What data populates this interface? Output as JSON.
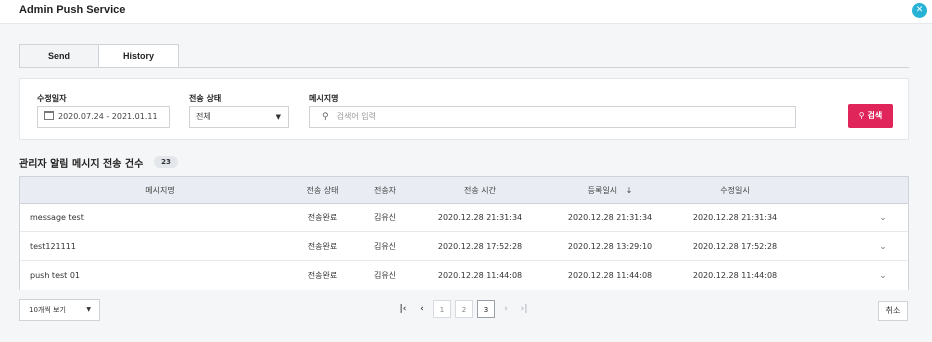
{
  "header": {
    "title": "Admin Push Service",
    "close_icon": "close-icon"
  },
  "tabs": [
    {
      "label": "Send"
    },
    {
      "label": "History"
    }
  ],
  "filters": {
    "date_label": "수정일자",
    "date_value": "2020.07.24 - 2021.01.11",
    "status_label": "전송 상태",
    "status_value": "전체",
    "message_label": "메시지명",
    "search_placeholder": "검색어 입력",
    "search_button": "검색"
  },
  "section": {
    "title": "관리자 알림 메시지 전송 건수",
    "count": "23"
  },
  "table": {
    "columns": [
      "메시지명",
      "전송 상태",
      "전송자",
      "전송 시간",
      "등록일시",
      "수정일시"
    ],
    "sort_icon": "arrow-down-icon",
    "rows": [
      {
        "message": "message test",
        "status": "전송완료",
        "sender": "김유신",
        "sent": "2020.12.28 21:31:34",
        "registered": "2020.12.28 21:31:34",
        "modified": "2020.12.28 21:31:34"
      },
      {
        "message": "test121111",
        "status": "전송완료",
        "sender": "김유신",
        "sent": "2020.12.28 17:52:28",
        "registered": "2020.12.28 13:29:10",
        "modified": "2020.12.28 17:52:28"
      },
      {
        "message": "push test 01",
        "status": "전송완료",
        "sender": "김유신",
        "sent": "2020.12.28 11:44:08",
        "registered": "2020.12.28 11:44:08",
        "modified": "2020.12.28 11:44:08"
      }
    ]
  },
  "footer": {
    "per_page": "10개씩 보기",
    "pages": [
      "1",
      "2",
      "3"
    ],
    "current_page": "3",
    "cancel": "취소"
  },
  "colors": {
    "accent": "#e0255a",
    "close": "#27b2d6",
    "header_bg": "#e9edf3"
  }
}
